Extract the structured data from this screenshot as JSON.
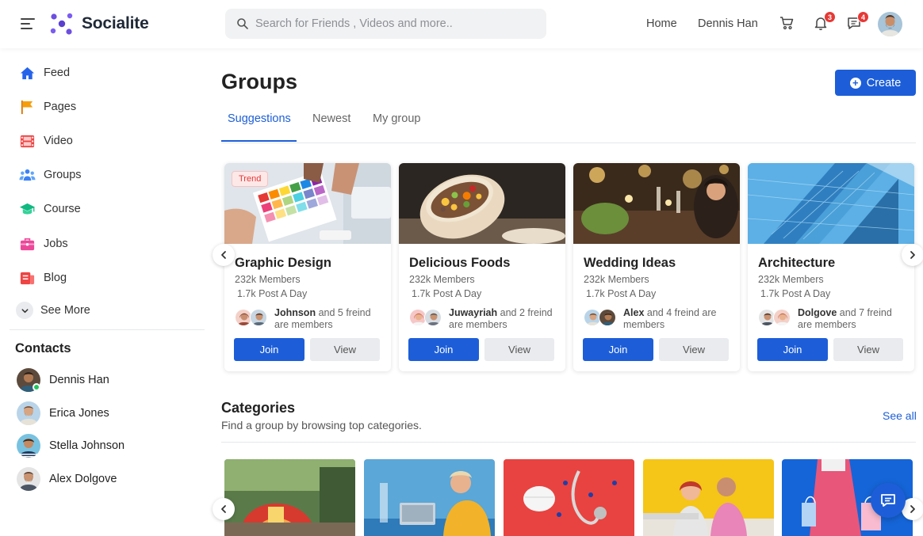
{
  "header": {
    "brand": "Socialite",
    "search_placeholder": "Search for Friends , Videos and more..",
    "nav_home": "Home",
    "nav_user": "Dennis Han",
    "notifications_count": "3",
    "messages_count": "4"
  },
  "sidebar": {
    "items": [
      {
        "label": "Feed",
        "icon": "home-icon"
      },
      {
        "label": "Pages",
        "icon": "flag-icon"
      },
      {
        "label": "Video",
        "icon": "film-icon"
      },
      {
        "label": "Groups",
        "icon": "users-icon"
      },
      {
        "label": "Course",
        "icon": "graduation-cap-icon"
      },
      {
        "label": "Jobs",
        "icon": "briefcase-icon"
      },
      {
        "label": "Blog",
        "icon": "blog-icon"
      }
    ],
    "see_more": "See More"
  },
  "contacts": {
    "title": "Contacts",
    "list": [
      {
        "name": "Dennis Han",
        "online": true
      },
      {
        "name": "Erica Jones",
        "online": false
      },
      {
        "name": "Stella Johnson",
        "online": false
      },
      {
        "name": "Alex Dolgove",
        "online": false
      }
    ]
  },
  "groups": {
    "title": "Groups",
    "create_label": "Create",
    "tabs": [
      {
        "label": "Suggestions",
        "active": true
      },
      {
        "label": "Newest",
        "active": false
      },
      {
        "label": "My group",
        "active": false
      }
    ],
    "cards": [
      {
        "title": "Graphic Design",
        "badge": "Trend",
        "members": "232k Members",
        "posts": "1.7k Post A Day",
        "friend_name": "Johnson",
        "friend_text": " and 5 freind are members",
        "join": "Join",
        "view": "View"
      },
      {
        "title": "Delicious Foods",
        "badge": "",
        "members": "232k Members",
        "posts": "1.7k Post A Day",
        "friend_name": "Juwayriah",
        "friend_text": " and 2 freind are members",
        "join": "Join",
        "view": "View"
      },
      {
        "title": "Wedding Ideas",
        "badge": "",
        "members": "232k Members",
        "posts": "1.7k Post A Day",
        "friend_name": "Alex",
        "friend_text": " and 4 freind are members",
        "join": "Join",
        "view": "View"
      },
      {
        "title": "Architecture",
        "badge": "",
        "members": "232k Members",
        "posts": "1.7k Post A Day",
        "friend_name": "Dolgove",
        "friend_text": " and 7 freind are members",
        "join": "Join",
        "view": "View"
      }
    ]
  },
  "categories": {
    "title": "Categories",
    "subtitle": "Find a group by browsing top categories.",
    "see_all": "See all"
  },
  "colors": {
    "accent": "#1d5ed8",
    "badge": "#e53935",
    "online": "#22c55e"
  }
}
